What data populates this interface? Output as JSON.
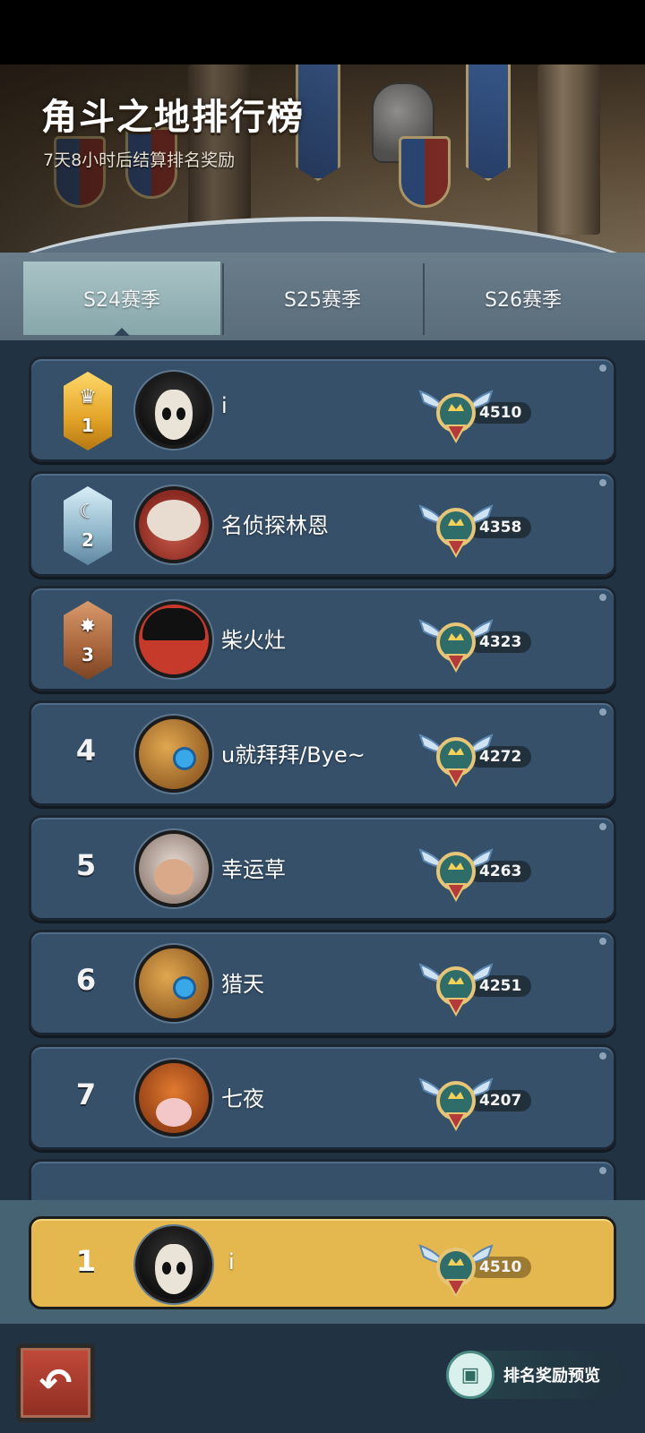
{
  "header": {
    "title": "角斗之地排行榜",
    "subtitle": "7天8小时后结算排名奖励"
  },
  "tabs": [
    {
      "label": "S24赛季",
      "active": true
    },
    {
      "label": "S25赛季",
      "active": false
    },
    {
      "label": "S26赛季",
      "active": false
    }
  ],
  "rows": [
    {
      "rank": "1",
      "medal": "gold",
      "avatar": "mask",
      "name": "i",
      "score": "4510"
    },
    {
      "rank": "2",
      "medal": "silver",
      "avatar": "snowman",
      "name": "名侦探林恩",
      "score": "4358"
    },
    {
      "rank": "3",
      "medal": "bronze",
      "avatar": "ninja",
      "name": "柴火灶",
      "score": "4323"
    },
    {
      "rank": "4",
      "medal": null,
      "avatar": "shell",
      "name": "u就拜拜/Bye~",
      "score": "4272"
    },
    {
      "rank": "5",
      "medal": null,
      "avatar": "girl",
      "name": "幸运草",
      "score": "4263"
    },
    {
      "rank": "6",
      "medal": null,
      "avatar": "shell",
      "name": "猎天",
      "score": "4251"
    },
    {
      "rank": "7",
      "medal": null,
      "avatar": "pumpkin",
      "name": "七夜",
      "score": "4207"
    }
  ],
  "my_rank": {
    "rank": "1",
    "avatar": "mask",
    "name": "i",
    "score": "4510"
  },
  "footer": {
    "back_icon": "back-arrow-icon",
    "reward_icon": "treasure-chest-icon",
    "reward_label": "排名奖励预览"
  },
  "colors": {
    "row_bg": "#36506a",
    "my_row_bg": "#e4b84f",
    "list_bg": "#213242",
    "active_tab": "#a9c3c6"
  }
}
